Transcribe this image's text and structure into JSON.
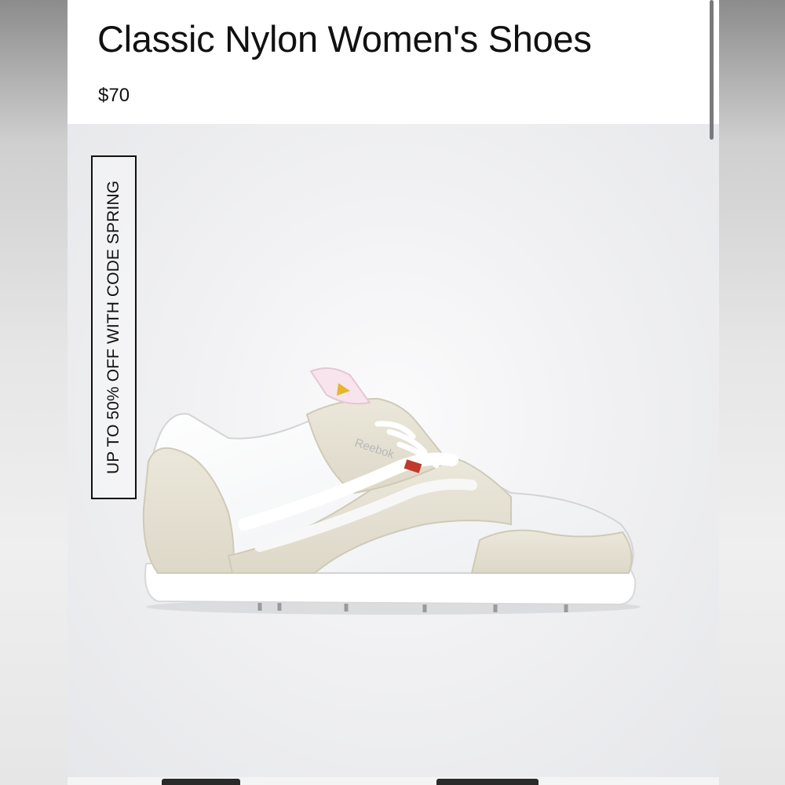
{
  "product": {
    "title": "Classic Nylon Women's Shoes",
    "price": "$70",
    "promo": "UP TO 50% OFF WITH CODE SPRING",
    "shoe_logo_text": "Reebok"
  },
  "colors": {
    "suede": "#e4e0d2",
    "mesh": "#f7f8f9",
    "sole": "#ffffff",
    "text": "#111111"
  }
}
